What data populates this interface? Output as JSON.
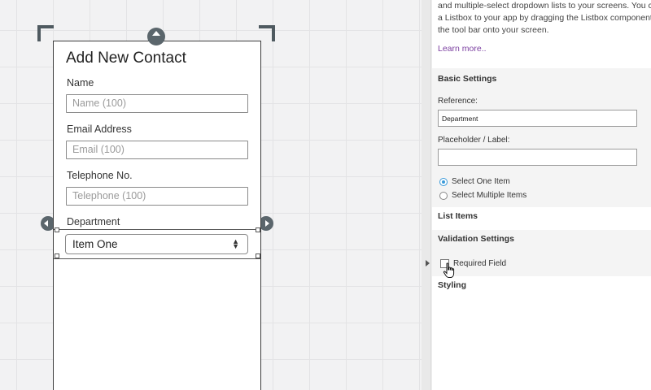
{
  "form": {
    "title": "Add New Contact",
    "fields": [
      {
        "label": "Name",
        "placeholder": "Name (100)"
      },
      {
        "label": "Email Address",
        "placeholder": "Email (100)"
      },
      {
        "label": "Telephone No.",
        "placeholder": "Telephone (100)"
      }
    ],
    "department": {
      "label": "Department",
      "selected": "Item One"
    }
  },
  "panel": {
    "description": [
      "and multiple-select dropdown lists to your screens. You ca",
      "a Listbox to your app by dragging the Listbox component fr",
      "the tool bar onto your screen."
    ],
    "learn_more": "Learn more..",
    "basic_settings": {
      "title": "Basic Settings",
      "reference_label": "Reference:",
      "reference_value": "Department",
      "placeholder_label": "Placeholder / Label:",
      "placeholder_value": "",
      "radio_options": [
        {
          "label": "Select One Item",
          "selected": true
        },
        {
          "label": "Select Multiple Items",
          "selected": false
        }
      ]
    },
    "list_items_title": "List Items",
    "validation": {
      "title": "Validation Settings",
      "required_label": "Required Field",
      "required_checked": false
    },
    "styling_title": "Styling"
  },
  "colors": {
    "accent_radio": "#3a9ad9",
    "link": "#7b3fa0",
    "handle": "#5b666c"
  }
}
